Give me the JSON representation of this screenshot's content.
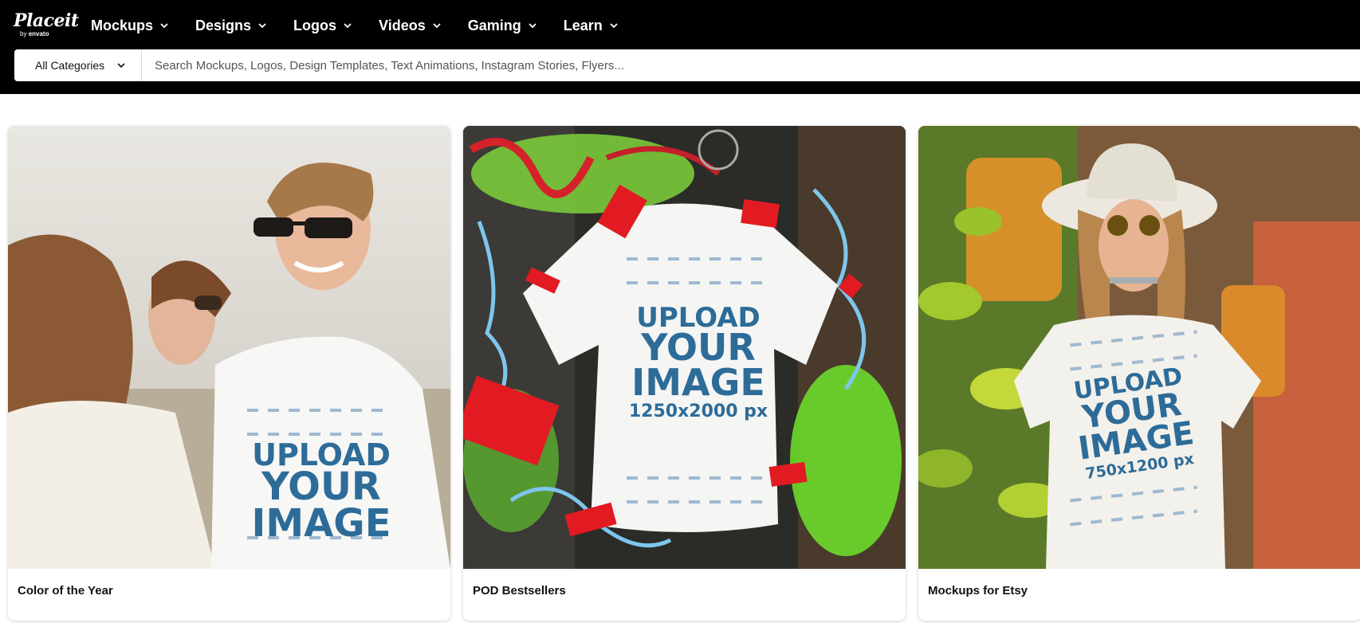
{
  "brand": {
    "name": "Placeit",
    "sub_prefix": "by",
    "sub_name": "envato"
  },
  "nav": {
    "items": [
      {
        "label": "Mockups",
        "icon": "chevron-down-icon"
      },
      {
        "label": "Designs",
        "icon": "chevron-down-icon"
      },
      {
        "label": "Logos",
        "icon": "chevron-down-icon"
      },
      {
        "label": "Videos",
        "icon": "chevron-down-icon"
      },
      {
        "label": "Gaming",
        "icon": "chevron-down-icon"
      },
      {
        "label": "Learn",
        "icon": "chevron-down-icon"
      }
    ]
  },
  "search": {
    "category_label": "All Categories",
    "placeholder": "Search Mockups, Logos, Design Templates, Text Animations, Instagram Stories, Flyers...",
    "value": ""
  },
  "cards": [
    {
      "caption": "Color of the Year",
      "shirt_lines": [
        "UPLOAD",
        "YOUR",
        "IMAGE"
      ]
    },
    {
      "caption": "POD Bestsellers",
      "shirt_lines": [
        "UPLOAD",
        "YOUR",
        "IMAGE",
        "1250x2000 px"
      ]
    },
    {
      "caption": "Mockups for Etsy",
      "shirt_lines": [
        "UPLOAD",
        "YOUR",
        "IMAGE",
        "750x1200 px"
      ]
    }
  ],
  "colors": {
    "header_bg": "#000000",
    "text_primary": "#111111",
    "shirt_print": "#2d6c98"
  }
}
